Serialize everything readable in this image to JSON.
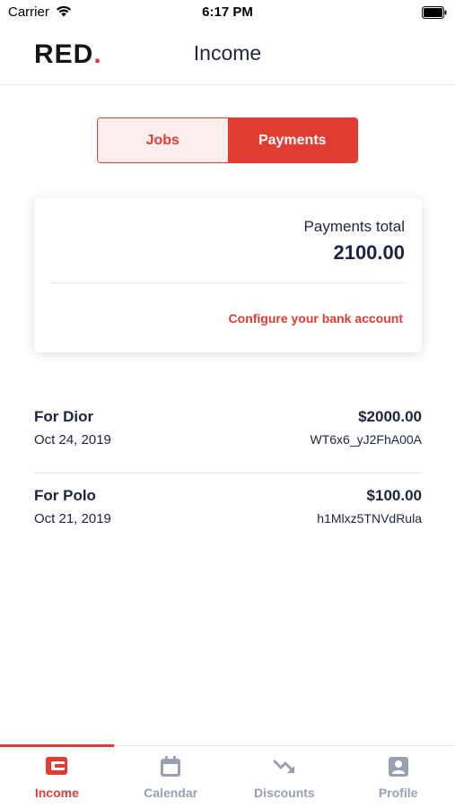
{
  "status_bar": {
    "carrier": "Carrier",
    "time": "6:17 PM"
  },
  "header": {
    "logo_text": "RED",
    "logo_dot": ".",
    "title": "Income"
  },
  "segment": {
    "jobs_label": "Jobs",
    "payments_label": "Payments",
    "selected": "Payments"
  },
  "summary": {
    "label": "Payments total",
    "total": "2100.00",
    "configure_link": "Configure your bank account"
  },
  "payments": [
    {
      "name": "For Dior",
      "date": "Oct 24, 2019",
      "amount": "$2000.00",
      "reference": "WT6x6_yJ2FhA00A"
    },
    {
      "name": "For Polo",
      "date": "Oct 21, 2019",
      "amount": "$100.00",
      "reference": "h1Mlxz5TNVdRula"
    }
  ],
  "tabs": [
    {
      "label": "Income",
      "icon": "wallet-icon",
      "active": true
    },
    {
      "label": "Calendar",
      "icon": "calendar-icon",
      "active": false
    },
    {
      "label": "Discounts",
      "icon": "trend-down-icon",
      "active": false
    },
    {
      "label": "Profile",
      "icon": "profile-icon",
      "active": false
    }
  ],
  "colors": {
    "accent": "#e23b32",
    "text": "#1f2440",
    "inactive": "#9aa0b3"
  }
}
